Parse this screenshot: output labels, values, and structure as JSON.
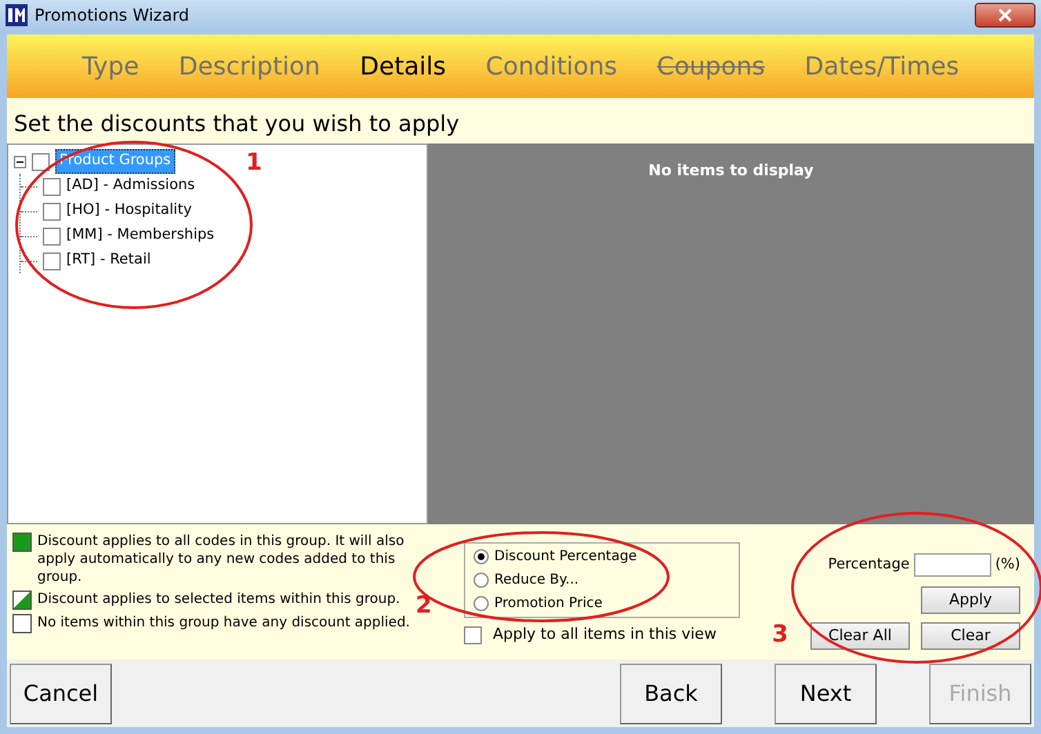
{
  "window": {
    "title": "Promotions Wizard"
  },
  "tabs": [
    {
      "label": "Type",
      "selected": false,
      "disabled": false
    },
    {
      "label": "Description",
      "selected": false,
      "disabled": false
    },
    {
      "label": "Details",
      "selected": true,
      "disabled": false
    },
    {
      "label": "Conditions",
      "selected": false,
      "disabled": false
    },
    {
      "label": "Coupons",
      "selected": false,
      "disabled": true
    },
    {
      "label": "Dates/Times",
      "selected": false,
      "disabled": false
    }
  ],
  "instruction": "Set the discounts that you wish to apply",
  "tree": {
    "label": "Product Groups",
    "expanded": true,
    "selected": true,
    "checked": false,
    "children": [
      {
        "label": "[AD] - Admissions",
        "checked": false
      },
      {
        "label": "[HO] - Hospitality",
        "checked": false
      },
      {
        "label": "[MM] - Memberships",
        "checked": false
      },
      {
        "label": "[RT] - Retail",
        "checked": false
      }
    ]
  },
  "items_panel": {
    "empty_message": "No items to display"
  },
  "legend": [
    {
      "kind": "full",
      "text": "Discount applies to all codes in this group. It will also apply automatically to any new codes added to this group."
    },
    {
      "kind": "partial",
      "text": "Discount applies to selected items within this group."
    },
    {
      "kind": "none",
      "text": "No items within this group have any discount applied."
    }
  ],
  "discount_types": [
    {
      "label": "Discount Percentage",
      "selected": true
    },
    {
      "label": "Reduce By...",
      "selected": false
    },
    {
      "label": "Promotion Price",
      "selected": false
    }
  ],
  "apply_all": {
    "label": "Apply to all items in this view",
    "checked": false
  },
  "percentage": {
    "label": "Percentage",
    "unit": "(%)"
  },
  "edit_buttons": [
    "Apply",
    "Clear All",
    "Clear"
  ],
  "footer_buttons": [
    {
      "label": "Cancel",
      "disabled": false
    },
    {
      "label": "Back",
      "disabled": false
    },
    {
      "label": "Next",
      "disabled": false
    },
    {
      "label": "Finish",
      "disabled": true
    }
  ],
  "annotations": [
    "1",
    "2",
    "3"
  ]
}
